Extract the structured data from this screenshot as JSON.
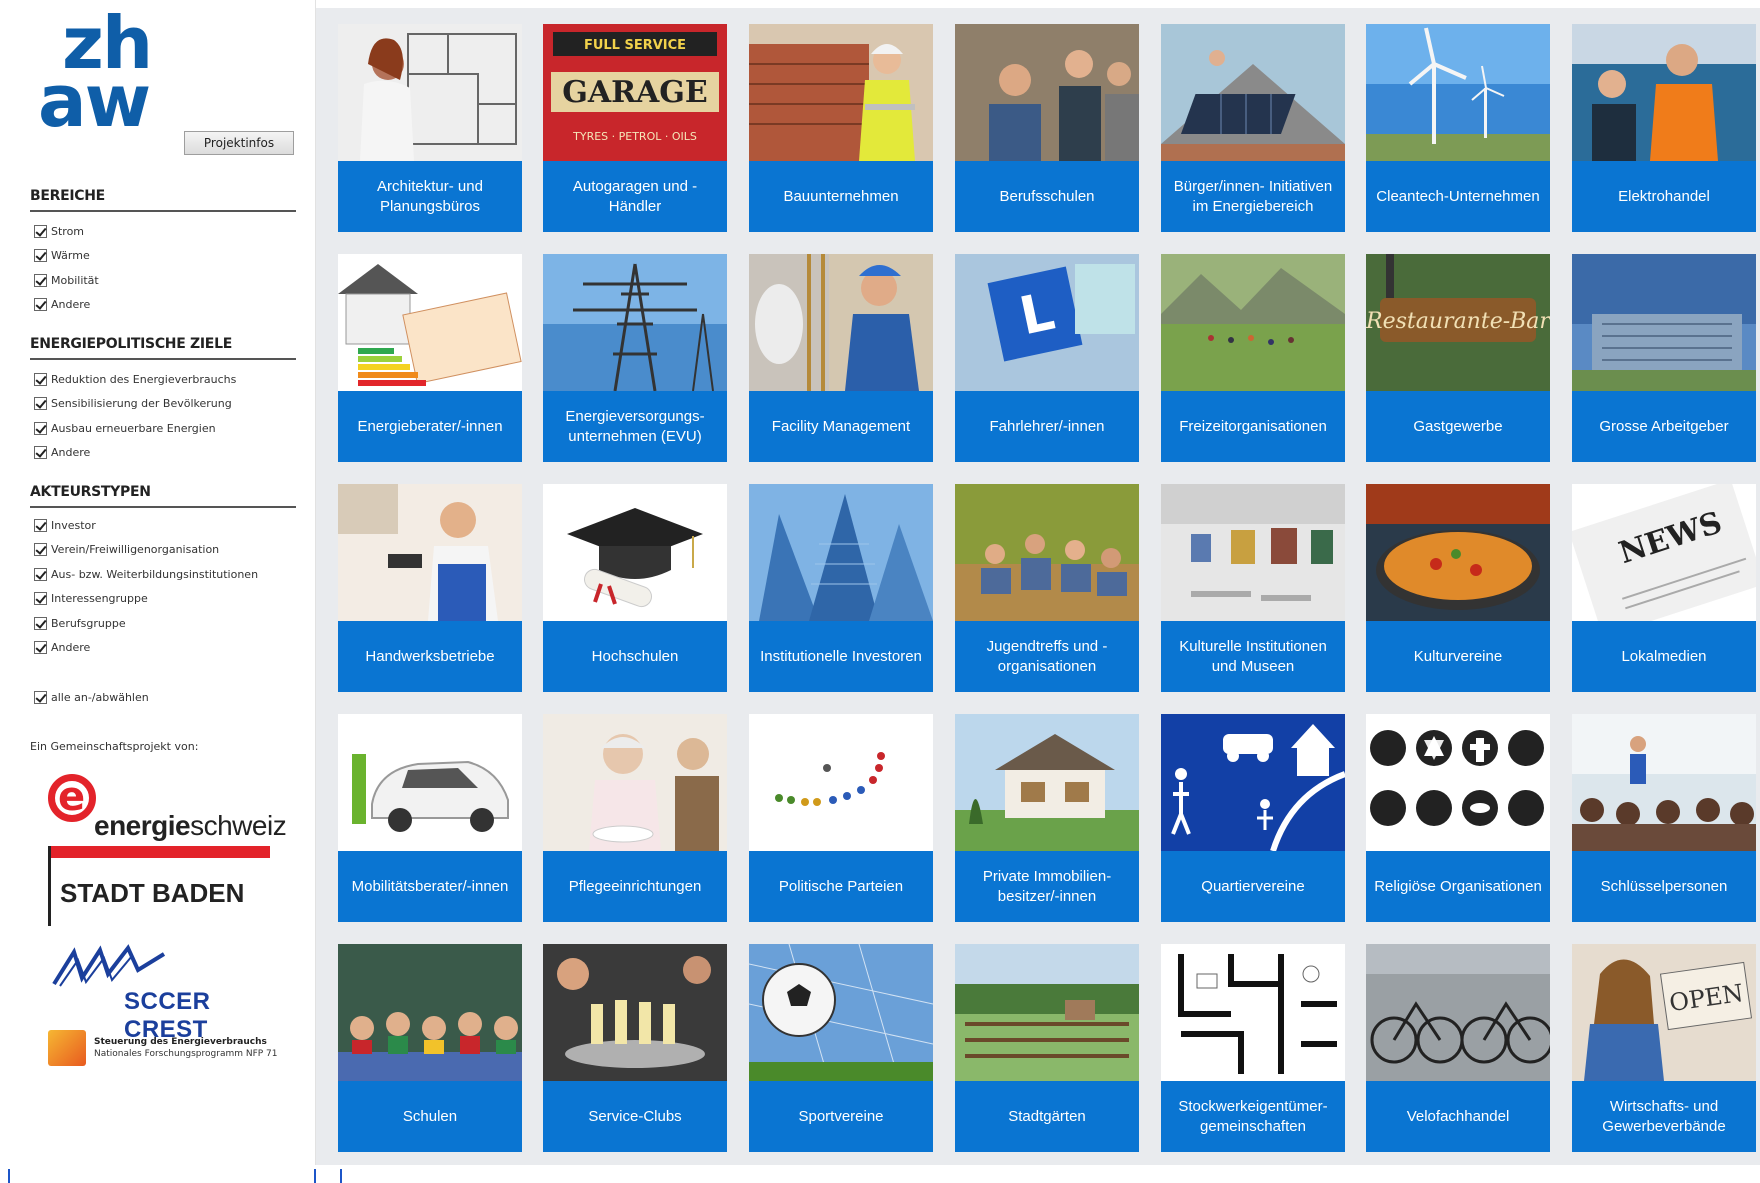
{
  "sidebar": {
    "logo_line1": "zh",
    "logo_line2": "aw",
    "projektinfos_label": "Projektinfos",
    "sections": [
      {
        "title": "BEREICHE",
        "items": [
          "Strom",
          "Wärme",
          "Mobilität",
          "Andere"
        ]
      },
      {
        "title": "ENERGIEPOLITISCHE ZIELE",
        "items": [
          "Reduktion des Energieverbrauchs",
          "Sensibilisierung der Bevölkerung",
          "Ausbau erneuerbare Energien",
          "Andere"
        ]
      },
      {
        "title": "AKTEURSTYPEN",
        "items": [
          "Investor",
          "Verein/Freiwilligenorganisation",
          "Aus- bzw. Weiterbildungsinstitutionen",
          "Interessengruppe",
          "Berufsgruppe",
          "Andere"
        ]
      }
    ],
    "select_all_label": "alle an-/abwählen",
    "partner_label": "Ein Gemeinschaftsprojekt von:",
    "partners": {
      "energie_bold": "energie",
      "energie_rest": "schweiz",
      "baden": "STADT BADEN",
      "sccer": "SCCER CREST",
      "nfp_line1": "Steuerung des Energieverbrauchs",
      "nfp_line2": "Nationales Forschungsprogramm NFP 71"
    }
  },
  "tiles": [
    [
      {
        "label": "Architektur- und Planungsbüros",
        "icon": "architect-icon"
      },
      {
        "label": "Autogaragen und -Händler",
        "icon": "garage-sign-icon"
      },
      {
        "label": "Bauunternehmen",
        "icon": "construction-worker-icon"
      },
      {
        "label": "Berufsschulen",
        "icon": "vocational-school-icon"
      },
      {
        "label": "Bürger/innen- Initiativen im Energiebereich",
        "icon": "solar-roof-icon"
      },
      {
        "label": "Cleantech-Unternehmen",
        "icon": "wind-turbine-icon"
      },
      {
        "label": "Elektrohandel",
        "icon": "electronics-shop-icon"
      }
    ],
    [
      {
        "label": "Energieberater/-innen",
        "icon": "energy-certificate-icon"
      },
      {
        "label": "Energieversorgungs- unternehmen (EVU)",
        "icon": "power-pylon-icon"
      },
      {
        "label": "Facility Management",
        "icon": "technician-icon"
      },
      {
        "label": "Fahrlehrer/-innen",
        "icon": "learner-sign-icon"
      },
      {
        "label": "Freizeitorganisationen",
        "icon": "hiking-group-icon"
      },
      {
        "label": "Gastgewerbe",
        "icon": "restaurant-sign-icon"
      },
      {
        "label": "Grosse Arbeitgeber",
        "icon": "office-building-icon"
      }
    ],
    [
      {
        "label": "Handwerksbetriebe",
        "icon": "electrician-icon"
      },
      {
        "label": "Hochschulen",
        "icon": "graduation-cap-icon"
      },
      {
        "label": "Institutionelle Investoren",
        "icon": "skyscraper-icon"
      },
      {
        "label": "Jugendtreffs und -organisationen",
        "icon": "youth-group-icon"
      },
      {
        "label": "Kulturelle Institutionen und Museen",
        "icon": "gallery-icon"
      },
      {
        "label": "Kulturvereine",
        "icon": "paella-icon"
      },
      {
        "label": "Lokalmedien",
        "icon": "newspaper-icon"
      }
    ],
    [
      {
        "label": "Mobilitätsberater/-innen",
        "icon": "electric-car-icon"
      },
      {
        "label": "Pflegeeinrichtungen",
        "icon": "elderly-care-icon"
      },
      {
        "label": "Politische Parteien",
        "icon": "party-figures-icon"
      },
      {
        "label": "Private Immobilien- besitzer/-innen",
        "icon": "house-icon"
      },
      {
        "label": "Quartiervereine",
        "icon": "neighborhood-icon"
      },
      {
        "label": "Religiöse Organisationen",
        "icon": "religion-symbols-icon"
      },
      {
        "label": "Schlüsselpersonen",
        "icon": "audience-icon"
      }
    ],
    [
      {
        "label": "Schulen",
        "icon": "schoolchildren-icon"
      },
      {
        "label": "Service-Clubs",
        "icon": "champagne-tray-icon"
      },
      {
        "label": "Sportvereine",
        "icon": "soccer-ball-icon"
      },
      {
        "label": "Stadtgärten",
        "icon": "allotment-garden-icon"
      },
      {
        "label": "Stockwerkeigentümer- gemeinschaften",
        "icon": "floor-plan-icon"
      },
      {
        "label": "Velofachhandel",
        "icon": "bicycles-icon"
      },
      {
        "label": "Wirtschafts- und Gewerbeverbände",
        "icon": "open-sign-icon"
      }
    ]
  ],
  "colors": {
    "tile_caption_bg": "#0a75d2",
    "main_bg": "#e9ebee",
    "logo_blue": "#0f5ea8",
    "energie_red": "#e3232a",
    "sccer_blue": "#1b3f9c"
  }
}
